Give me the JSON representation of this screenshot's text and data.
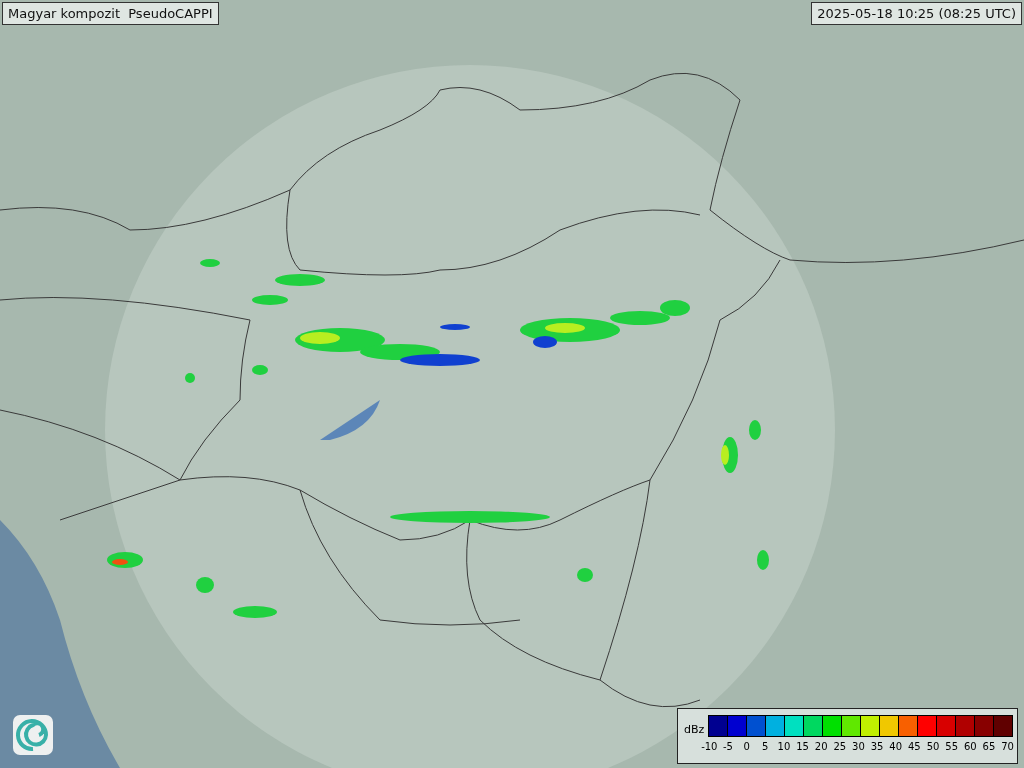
{
  "title": "Magyar kompozit  PseudoCAPPI",
  "timestamp": "2025-05-18 10:25 (08:25 UTC)",
  "legend": {
    "unit": "dBz",
    "bins": [
      {
        "color": "#000090"
      },
      {
        "color": "#0000d0"
      },
      {
        "color": "#0050d0"
      },
      {
        "color": "#00b0e0"
      },
      {
        "color": "#00e0c0"
      },
      {
        "color": "#00d860"
      },
      {
        "color": "#00e000"
      },
      {
        "color": "#60e800"
      },
      {
        "color": "#c0f000"
      },
      {
        "color": "#f0c800"
      },
      {
        "color": "#f86000"
      },
      {
        "color": "#ff0000"
      },
      {
        "color": "#d80000"
      },
      {
        "color": "#b00000"
      },
      {
        "color": "#880000"
      },
      {
        "color": "#600000"
      }
    ],
    "ticks": [
      "-10",
      "-5",
      "0",
      "5",
      "10",
      "15",
      "20",
      "25",
      "30",
      "35",
      "40",
      "45",
      "50",
      "55",
      "60",
      "65",
      "70"
    ]
  }
}
